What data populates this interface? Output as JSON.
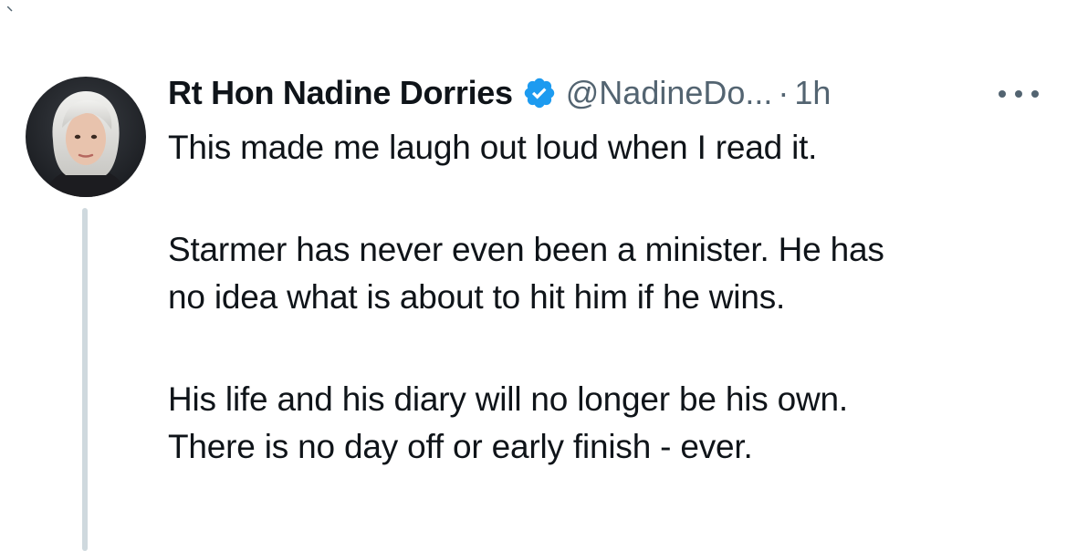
{
  "tweet": {
    "author_name": "Rt Hon Nadine Dorries",
    "handle": "@NadineDo...",
    "separator": "·",
    "time": "1h",
    "verified": true,
    "paragraphs": [
      [
        "This made me laugh out loud when I read it."
      ],
      [
        "Starmer has never even been a minister. He has",
        "no idea what is about to hit him if he wins."
      ],
      [
        "His life and his diary will no longer be his own.",
        "There is no day off or early finish - ever."
      ]
    ]
  },
  "icons": {
    "verified": "verified-badge-icon",
    "more": "more-options-icon",
    "avatar": "profile-photo"
  },
  "colors": {
    "text": "#0f1419",
    "secondary": "#536471",
    "verified_blue": "#1d9bf0",
    "thread_line": "#cfd9de"
  }
}
